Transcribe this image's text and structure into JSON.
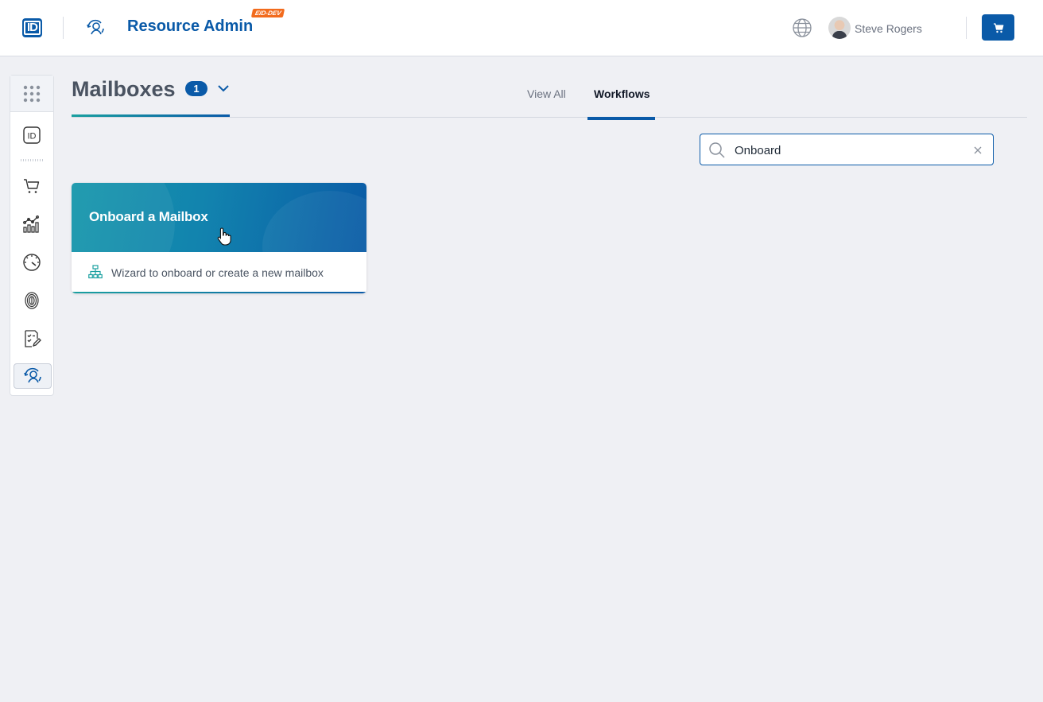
{
  "header": {
    "logo_text": "ID",
    "app_title": "Resource Admin",
    "env_badge": "EID-DEV",
    "user_name": "Steve Rogers"
  },
  "page": {
    "title": "Mailboxes",
    "count": "1"
  },
  "tabs": [
    {
      "label": "View All",
      "active": false
    },
    {
      "label": "Workflows",
      "active": true
    }
  ],
  "search": {
    "value": "Onboard"
  },
  "cards": [
    {
      "title": "Onboard a Mailbox",
      "description": "Wizard to onboard or create a new mailbox",
      "icon": "workflow-icon"
    }
  ],
  "sidebar": {
    "items": [
      {
        "icon": "apps-grid-icon"
      },
      {
        "icon": "id-icon"
      },
      {
        "icon": "cart-icon"
      },
      {
        "icon": "analytics-icon"
      },
      {
        "icon": "gauge-icon"
      },
      {
        "icon": "fingerprint-icon"
      },
      {
        "icon": "checklist-icon"
      },
      {
        "icon": "resource-admin-icon"
      }
    ]
  },
  "colors": {
    "brand": "#0a5aa8",
    "accent_teal": "#1aa0a0",
    "env_badge": "#f26b1d",
    "background": "#eff0f4"
  }
}
